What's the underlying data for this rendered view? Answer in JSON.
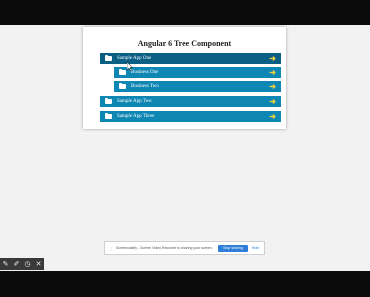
{
  "page": {
    "title": "Angular 6 Tree Component"
  },
  "tree": {
    "nodes": [
      {
        "label": "Sample App One",
        "selected": true
      },
      {
        "label": "Business One",
        "selected": false
      },
      {
        "label": "Business Two",
        "selected": false
      },
      {
        "label": "Sample App Two",
        "selected": false
      },
      {
        "label": "Sample App Three",
        "selected": false
      }
    ],
    "expand_icon": "arrow-right-icon",
    "folder_icon": "folder-icon"
  },
  "recorder": {
    "message": "Screencastify - Screen Video Recorder is sharing your screen.",
    "stop_label": "Stop sharing",
    "hide_label": "Hide"
  },
  "colors": {
    "node": "#0f87b4",
    "node_selected": "#0b5f85",
    "arrow": "#f6d33c",
    "button": "#2f7ed8"
  }
}
